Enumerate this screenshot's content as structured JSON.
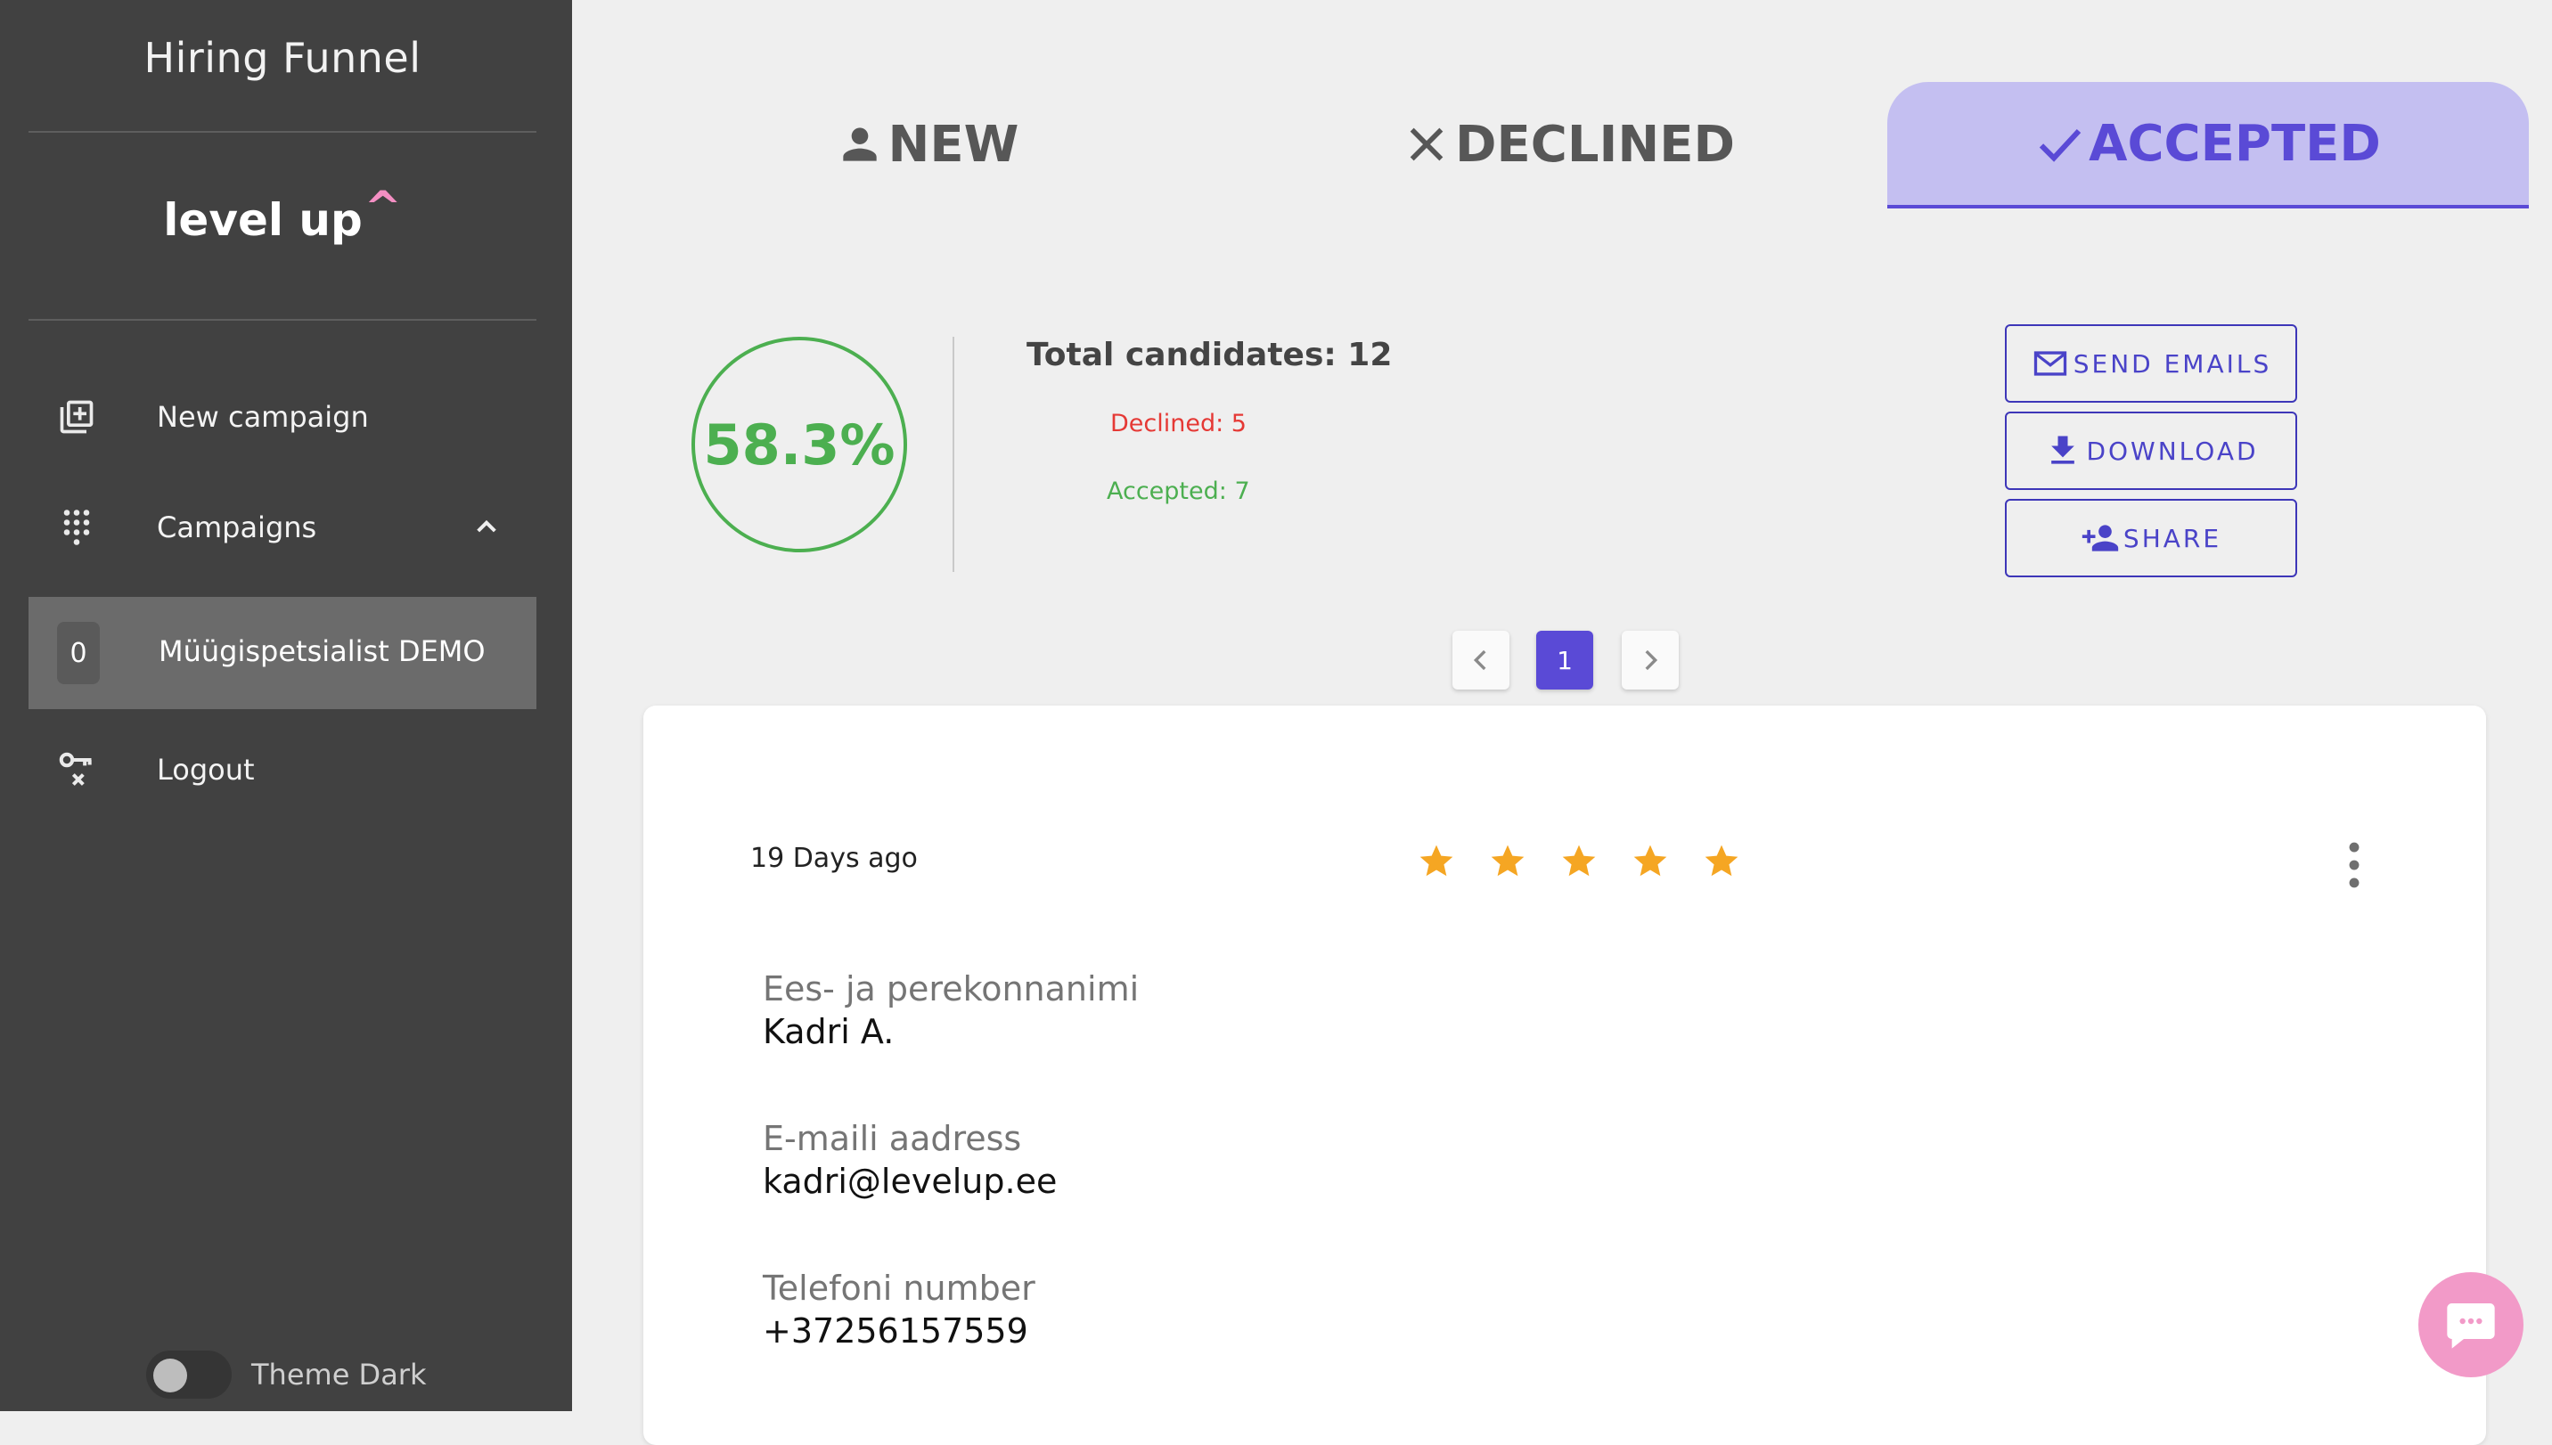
{
  "sidebar": {
    "title": "Hiring Funnel",
    "logo": {
      "text": "level up",
      "caret": "^"
    },
    "nav": {
      "new_campaign": "New campaign",
      "campaigns": "Campaigns",
      "campaign_item": {
        "count": "0",
        "label": "Müügispetsialist DEMO"
      },
      "logout": "Logout"
    },
    "theme_toggle": {
      "label": "Theme Dark",
      "enabled": false
    }
  },
  "tabs": [
    {
      "label": "NEW",
      "icon": "person-icon",
      "active": false
    },
    {
      "label": "DECLINED",
      "icon": "close-icon",
      "active": false
    },
    {
      "label": "ACCEPTED",
      "icon": "check-icon",
      "active": true
    }
  ],
  "stats": {
    "percentage": "58.3%",
    "total": "Total candidates: 12",
    "declined": "Declined: 5",
    "accepted": "Accepted: 7"
  },
  "actions": {
    "send_emails": "SEND EMAILS",
    "download": "DOWNLOAD",
    "share": "SHARE"
  },
  "pagination": {
    "current": "1"
  },
  "candidate": {
    "time_ago": "19 Days ago",
    "rating": 5,
    "rating_max": 5,
    "fields": [
      {
        "label": "Ees- ja perekonnanimi",
        "value": "Kadri A."
      },
      {
        "label": "E-maili aadress",
        "value": "kadri@levelup.ee"
      },
      {
        "label": "Telefoni number",
        "value": "+37256157559"
      }
    ]
  },
  "colors": {
    "sidebar_bg": "#414141",
    "accent": "#5a4ad6",
    "accent_soft": "#c4bff1",
    "success": "#4caf50",
    "danger": "#e53935",
    "star": "#f5a623",
    "chat": "#f29ac8"
  }
}
